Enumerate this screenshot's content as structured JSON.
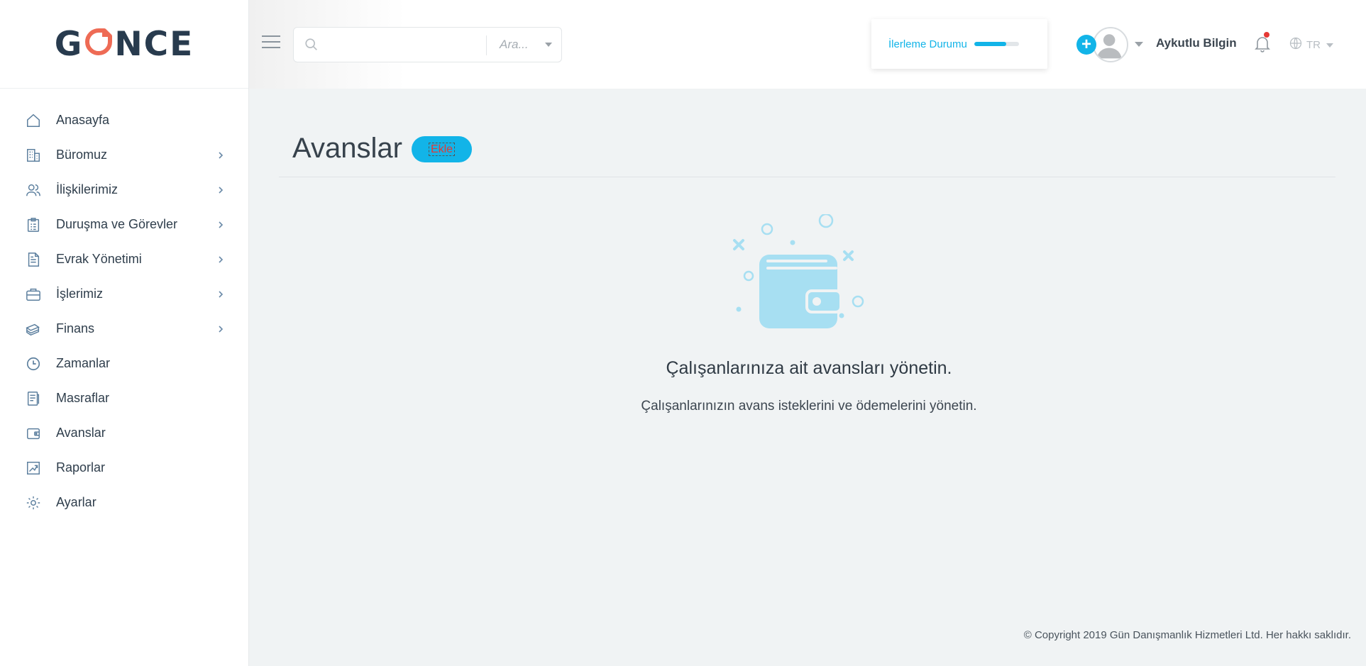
{
  "app": {
    "logo_text_left": "G",
    "logo_text_right": "NCE",
    "brand_color": "#283b4e",
    "accent_color": "#12b4e8",
    "logo_mark_color": "#ee6b55"
  },
  "sidebar": {
    "items": [
      {
        "label": "Anasayfa",
        "icon": "home-icon",
        "has_children": false
      },
      {
        "label": "Büromuz",
        "icon": "building-icon",
        "has_children": true
      },
      {
        "label": "İlişkilerimiz",
        "icon": "users-icon",
        "has_children": true
      },
      {
        "label": "Duruşma ve Görevler",
        "icon": "clipboard-icon",
        "has_children": true
      },
      {
        "label": "Evrak Yönetimi",
        "icon": "document-icon",
        "has_children": true
      },
      {
        "label": "İşlerimiz",
        "icon": "briefcase-icon",
        "has_children": true
      },
      {
        "label": "Finans",
        "icon": "money-icon",
        "has_children": true
      },
      {
        "label": "Zamanlar",
        "icon": "clock-icon",
        "has_children": false
      },
      {
        "label": "Masraflar",
        "icon": "receipt-icon",
        "has_children": false
      },
      {
        "label": "Avanslar",
        "icon": "wallet-icon",
        "has_children": false
      },
      {
        "label": "Raporlar",
        "icon": "chart-icon",
        "has_children": false
      },
      {
        "label": "Ayarlar",
        "icon": "gear-icon",
        "has_children": false
      }
    ]
  },
  "header": {
    "search": {
      "value": "",
      "placeholder": "",
      "select_label": "Ara..."
    },
    "progress": {
      "label": "İlerleme Durumu",
      "value_fraction": 0.72
    },
    "user": {
      "name": "Aykutlu Bilgin"
    },
    "language": {
      "label": "TR"
    }
  },
  "main": {
    "title": "Avanslar",
    "add_button_label": "Ekle",
    "empty_state": {
      "heading": "Çalışanlarınıza ait avansları yönetin.",
      "subheading": "Çalışanlarınızın avans isteklerini ve ödemelerini yönetin."
    }
  },
  "footer": {
    "copyright": "© Copyright 2019 Gün Danışmanlık Hizmetleri Ltd. Her hakkı saklıdır."
  }
}
